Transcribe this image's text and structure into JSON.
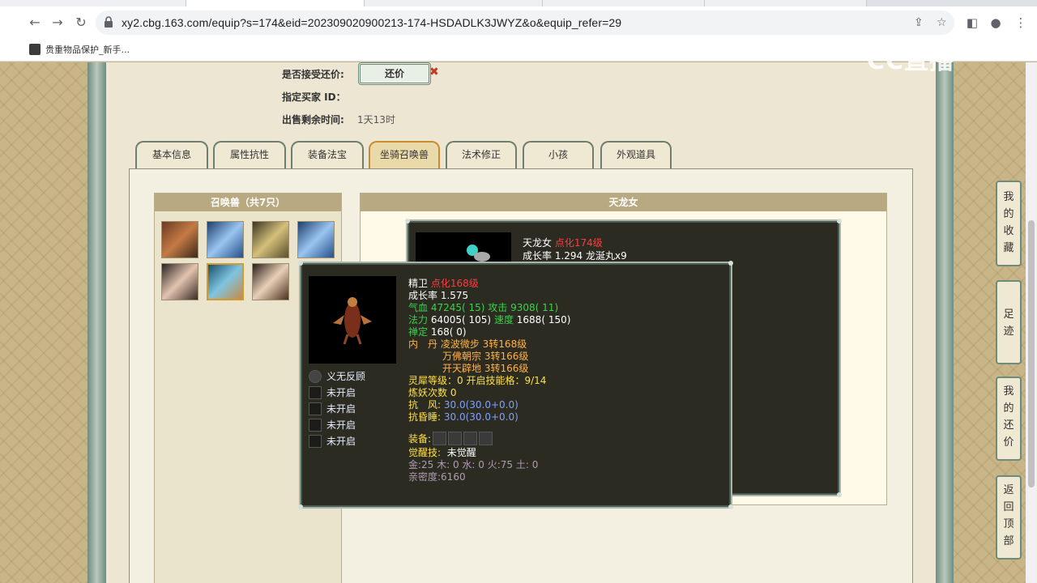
{
  "browser": {
    "url": "xy2.cbg.163.com/equip?s=174&eid=202309020900213-174-HSDADLK3JWYZ&o&equip_refer=29",
    "bookmark": "贵重物品保护_新手..."
  },
  "watermark": "CC直播",
  "sale_info": {
    "accept_offer_label": "是否接受还价:",
    "offer_button": "还价",
    "buyer_id_label": "指定买家 ID：",
    "time_left_label": "出售剩余时间:",
    "time_left_value": "1天13时"
  },
  "tabs": [
    "基本信息",
    "属性抗性",
    "装备法宝",
    "坐骑召唤兽",
    "法术修正",
    "小孩",
    "外观道具"
  ],
  "pet_list": {
    "header": "召唤兽（共7只）"
  },
  "pet_detail": {
    "header": "天龙女",
    "name": "天龙女",
    "level": "点化174级",
    "growth": "成长率 1.294 龙涎丸x9"
  },
  "tooltip": {
    "name": "精卫",
    "level": "点化168级",
    "growth": "成长率 1.575",
    "hp_label": "气血",
    "hp": "47245( 15)",
    "atk_label": "攻击",
    "atk": "9308( 11)",
    "mp_label": "法力",
    "mp": "64005( 105)",
    "spd_label": "速度",
    "spd": "1688( 150)",
    "zen_label": "禅定",
    "zen": "168( 0)",
    "neidan_label": "内　丹",
    "neidan": [
      "凌波微步 3转168级",
      "万佛朝宗 3转166级",
      "开天辟地 3转166级"
    ],
    "spirit": "灵犀等级：0 开启技能格：9/14",
    "refine": "炼妖次数 0",
    "res_wind_label": "抗　风:",
    "res_wind": "30.0(30.0+0.0)",
    "res_sleep_label": "抗昏睡:",
    "res_sleep": "30.0(30.0+0.0)",
    "equip_label": "装备:",
    "awaken_label": "觉醒技:",
    "awaken": "未觉醒",
    "elements": "金:25 木: 0 水: 0 火:75 土: 0",
    "intimacy": "亲密度:6160",
    "skills": [
      "义无反顾",
      "未开启",
      "未开启",
      "未开启",
      "未开启"
    ]
  },
  "side_buttons": [
    [
      "我",
      "的",
      "收",
      "藏"
    ],
    [
      "足",
      "迹"
    ],
    [
      "我",
      "的",
      "还",
      "价"
    ],
    [
      "返",
      "回",
      "顶",
      "部"
    ]
  ]
}
